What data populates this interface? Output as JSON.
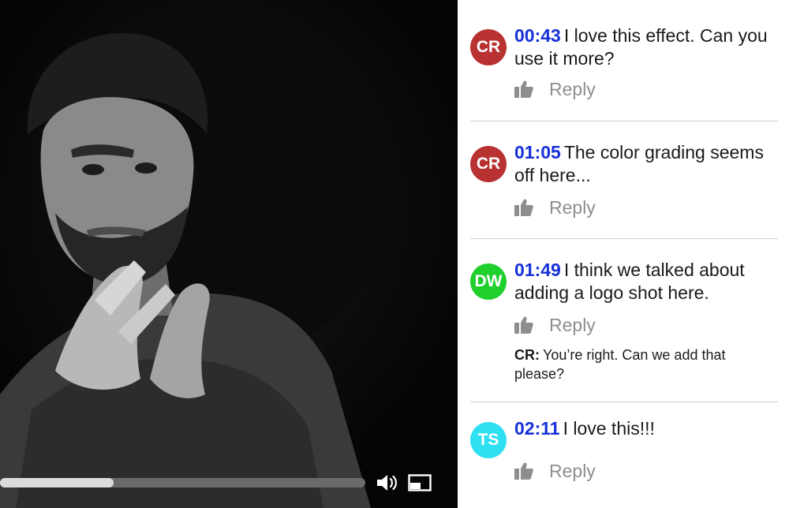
{
  "player": {
    "progress": 0.31,
    "volume_icon": "volume-icon",
    "pip_icon": "picture-in-picture-icon"
  },
  "colors": {
    "timestamp": "#1530d8",
    "reply": "#8e8e8e",
    "divider": "#cfcfcf"
  },
  "comments": [
    {
      "initials": "CR",
      "avatar_color": "#b83232",
      "timestamp": "00:43",
      "text": "I love this effect. Can you use it more?",
      "reply_label": "Reply",
      "like_icon": "thumbs-up-icon"
    },
    {
      "initials": "CR",
      "avatar_color": "#b83232",
      "timestamp": "01:05",
      "text": "The color grading seems off here...",
      "reply_label": "Reply",
      "like_icon": "thumbs-up-icon"
    },
    {
      "initials": "DW",
      "avatar_color": "#1fcf2c",
      "timestamp": "01:49",
      "text": "I think we talked about adding a logo shot here.",
      "reply_label": "Reply",
      "like_icon": "thumbs-up-icon",
      "reply": {
        "author": "CR:",
        "text": "You’re right. Can we add that please?"
      }
    },
    {
      "initials": "TS",
      "avatar_color": "#2ee0f2",
      "timestamp": "02:11",
      "text": "I love this!!!",
      "reply_label": "Reply",
      "like_icon": "thumbs-up-icon"
    }
  ]
}
